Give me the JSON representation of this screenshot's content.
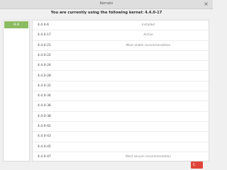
{
  "window": {
    "title": "Kernels"
  },
  "headline": "You are currently using the following kernel: 4.4.0-17",
  "sidebar": {
    "tabs": [
      {
        "label": "4.4"
      }
    ]
  },
  "kernels": [
    {
      "version": "4.4.0-6",
      "status": "Installed"
    },
    {
      "version": "4.4.0-17",
      "status": "Active"
    },
    {
      "version": "4.4.0-21",
      "status": "Most stable recommendation"
    },
    {
      "version": "4.4.0-22",
      "status": ""
    },
    {
      "version": "4.4.0-24",
      "status": ""
    },
    {
      "version": "4.4.0-28",
      "status": ""
    },
    {
      "version": "4.4.0-31",
      "status": ""
    },
    {
      "version": "4.4.0-34",
      "status": ""
    },
    {
      "version": "4.4.0-36",
      "status": ""
    },
    {
      "version": "4.4.0-38",
      "status": ""
    },
    {
      "version": "4.4.0-42",
      "status": ""
    },
    {
      "version": "4.4.0-43",
      "status": ""
    },
    {
      "version": "4.4.0-45",
      "status": ""
    },
    {
      "version": "4.4.0-47",
      "status": "Most secure recommendation"
    }
  ],
  "footer": {
    "button_label": "C"
  }
}
